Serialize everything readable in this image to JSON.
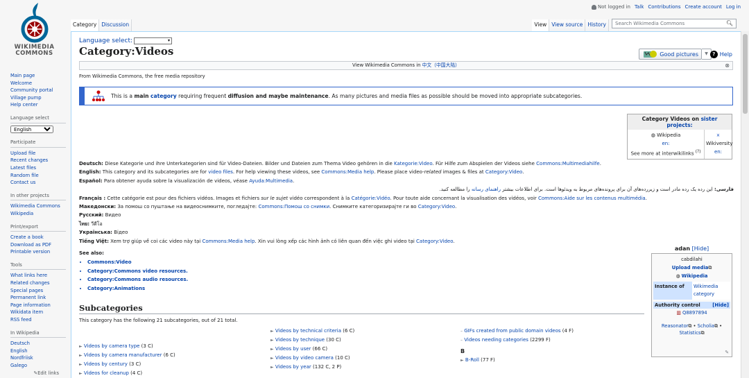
{
  "personal": {
    "not_logged_in": "Not logged in",
    "talk": "Talk",
    "contributions": "Contributions",
    "create_account": "Create account",
    "log_in": "Log in"
  },
  "logo": {
    "line1": "WIKIMEDIA",
    "line2": "COMMONS"
  },
  "sidebar": {
    "nav": [
      "Main page",
      "Welcome",
      "Community portal",
      "Village pump",
      "Help center"
    ],
    "language_select_label": "Language select",
    "language_value": "English",
    "participate_label": "Participate",
    "participate": [
      "Upload file",
      "Recent changes",
      "Latest files",
      "Random file",
      "Contact us"
    ],
    "other_projects_label": "In other projects",
    "other_projects": [
      "Wikimedia Commons",
      "Wikipedia"
    ],
    "print_label": "Print/export",
    "print": [
      "Create a book",
      "Download as PDF",
      "Printable version"
    ],
    "tools_label": "Tools",
    "tools": [
      "What links here",
      "Related changes",
      "Special pages",
      "Permanent link",
      "Page information",
      "Wikidata item",
      "RSS feed"
    ],
    "wikipedia_label": "In Wikipedia",
    "wikipedia": [
      "Deutsch",
      "English",
      "Nordfriisk",
      "Galego"
    ],
    "edit_links": "Edit links"
  },
  "tabs": {
    "category": "Category",
    "discussion": "Discussion",
    "view": "View",
    "view_source": "View source",
    "history": "History"
  },
  "search": {
    "placeholder": "Search Wikimedia Commons"
  },
  "content": {
    "language_select": "Language select:",
    "title": "Category:Videos",
    "good_pictures": "Good pictures",
    "help": "Help",
    "viewbar_pre": "View Wikimedia Commons in ",
    "viewbar_link": "中文（中国大陆）",
    "from": "From Wikimedia Commons, the free media repository",
    "notice": {
      "pre": "This is a ",
      "main": "main",
      "category": "category",
      "mid": " requiring frequent ",
      "diffusion": "diffusion and maybe maintenance",
      "post": ". As many pictures and media files as possible should be moved into appropriate subcategories."
    },
    "sister": {
      "header_pre": "Category Videos on ",
      "header_link": "sister projects:",
      "wikipedia": "Wikipedia",
      "en1": "en:",
      "wikiversity": "Wikiversity",
      "en2": "en:",
      "see_more": "See more at interwikilinks",
      "sup": "(?)"
    },
    "desc": {
      "de_label": "Deutsch:",
      "de_text1": " Diese Kategorie und ihre Unterkategorien sind für Video-Dateien. Bilder und Dateien zum Thema Video gehören in die ",
      "de_link1": "Kategorie:Video",
      "de_text2": ". Für Hilfe zum Abspielen der Videos siehe ",
      "de_link2": "Commons:Multimediahilfe",
      "de_text3": ".",
      "en_label": "English:",
      "en_text1": " This category and its subcategories are for ",
      "en_link1": "video files",
      "en_text2": ". For help viewing these videos, see ",
      "en_link2": "Commons:Media help",
      "en_text3": ". Please place video-",
      "en_em": "related",
      "en_text4": " images & files at ",
      "en_link3": "Category:Video",
      "en_text5": ".",
      "es_label": "Español:",
      "es_text1": " Para obtener ayuda sobre la visualización de videos, véase ",
      "es_link1": "Ayuda:Multimedia",
      "es_text2": ".",
      "fa_label": "فارسی:",
      "fa_text1": " این رده یک رده مادر است و زیررده‌های آن برای پرونده‌های مربوط به ویدئوها است. برای اطلاعات بیشتر ",
      "fa_link1": "راهنمای رسانه",
      "fa_text2": " را مطالعه کنید.",
      "fr_label": "Français :",
      "fr_text1": " Cette catégorie est pour des fichiers vidéos. Images et fichiers ",
      "fr_em": "sur le sujet",
      "fr_text2": " vidéo correspondent à la ",
      "fr_link1": "Catégorie:Vidéo",
      "fr_text3": ". Pour toute aide concernant la visualisation des vidéos, voir ",
      "fr_link2": "Commons:Aide sur les contenus multimédia",
      "fr_text4": ".",
      "mk_label": "Македонски:",
      "mk_text1": " За помош со пуштање на видеоснимките, погледајте: ",
      "mk_link1": "Commons:Помош со снимки",
      "mk_text2": ". Снимките категоризирајте ги во ",
      "mk_link2": "Category:Video",
      "mk_text3": ".",
      "ru_label": "Русский:",
      "ru_text": " Видео",
      "th_label": "ไทย:",
      "th_text": " วีดีโอ",
      "uk_label": "Українська:",
      "uk_text": " Відео",
      "vi_label": "Tiếng Việt:",
      "vi_text1": " Xem trợ giúp về coi các video này tại ",
      "vi_link1": "Commons:Media help",
      "vi_text2": ". Xin vui lòng xếp các hình ảnh có liên quan đến việc ghi video tại ",
      "vi_link2": "Category:Video",
      "vi_text3": "."
    },
    "see_also": {
      "label": "See also:",
      "items": [
        "Commons:Video",
        "Category:Commons video resources.",
        "Category:Commons audio resources.",
        "Category:Animations"
      ]
    },
    "subcategories": {
      "heading": "Subcategories",
      "text": "This category has the following 21 subcategories, out of 21 total.",
      "col1": [
        {
          "name": "Videos by camera type",
          "count": " (3 C)"
        },
        {
          "name": "Videos by camera manufacturer",
          "count": " (6 C)"
        },
        {
          "name": "Videos by century",
          "count": " (3 C)"
        },
        {
          "name": "Videos for cleanup",
          "count": " (4 C)"
        }
      ],
      "col2": [
        {
          "name": "Videos by technical criteria",
          "count": " (6 C)"
        },
        {
          "name": "Videos by technique",
          "count": " (30 C)"
        },
        {
          "name": "Videos by user",
          "count": " (66 C)"
        },
        {
          "name": "Videos by video camera",
          "count": " (10 C)"
        },
        {
          "name": "Videos by year",
          "count": " (132 C, 2 P)"
        }
      ],
      "col3": [
        {
          "name": "GIFs created from public domain videos",
          "count": " (4 F)"
        },
        {
          "name": "Videos needing categories",
          "count": " (2299 F)"
        }
      ],
      "col3_header_b": "B",
      "col3_b": [
        {
          "name": "B-Roll",
          "count": " (77 F)"
        }
      ]
    },
    "authority": {
      "title": "adan",
      "hide": "[Hide]",
      "subtitle": "cabdilahi",
      "upload_media": "Upload media",
      "wikipedia": "Wikipedia",
      "instance_of": "Instance of",
      "instance_value": "Wikimedia category",
      "authority_control": "Authority control",
      "hide2": "[Hide]",
      "qid": "Q8897894",
      "reasonator": "Reasonator",
      "scholia": "Scholia",
      "statistics": "Statistics"
    }
  }
}
